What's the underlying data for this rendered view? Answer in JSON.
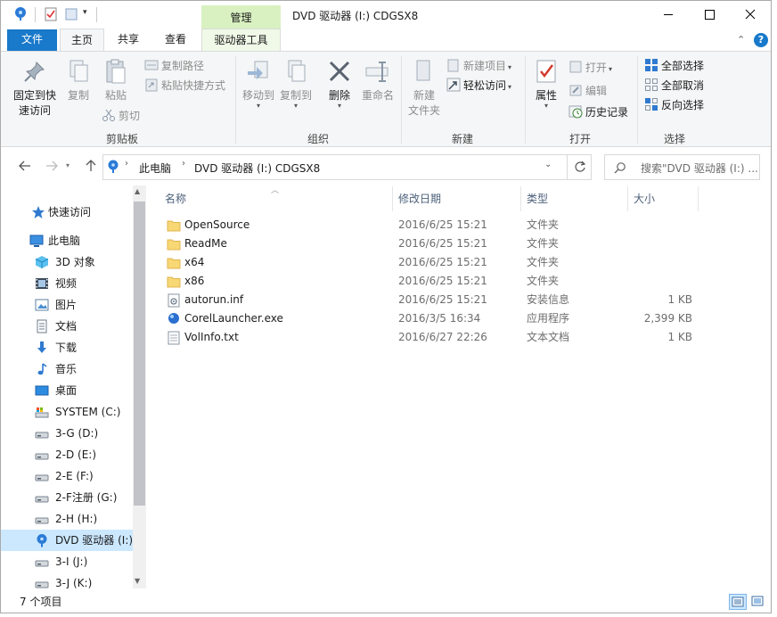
{
  "window": {
    "title": "DVD 驱动器 (I:) CDGSX8",
    "context_group": "管理"
  },
  "tabs": [
    {
      "label": "文件"
    },
    {
      "label": "主页"
    },
    {
      "label": "共享"
    },
    {
      "label": "查看"
    },
    {
      "label": "驱动器工具"
    }
  ],
  "ribbon": {
    "clipboard": {
      "pin": "固定到快\n速访问",
      "copy": "复制",
      "paste": "粘贴",
      "copy_path": "复制路径",
      "paste_shortcut": "粘贴快捷方式",
      "cut": "剪切",
      "label": "剪贴板"
    },
    "organize": {
      "move_to": "移动到",
      "copy_to": "复制到",
      "delete": "删除",
      "rename": "重命名",
      "label": "组织"
    },
    "new": {
      "new_folder": "新建\n文件夹",
      "new_item": "新建项目",
      "easy_access": "轻松访问",
      "label": "新建"
    },
    "open": {
      "properties": "属性",
      "open": "打开",
      "edit": "编辑",
      "history": "历史记录",
      "label": "打开"
    },
    "select": {
      "select_all": "全部选择",
      "select_none": "全部取消",
      "invert": "反向选择",
      "label": "选择"
    }
  },
  "address": {
    "crumbs": [
      "此电脑",
      "DVD 驱动器 (I:) CDGSX8"
    ],
    "search_placeholder": "搜索\"DVD 驱动器 (I:) ..."
  },
  "nav": {
    "quick_access": "快速访问",
    "this_pc": "此电脑",
    "items": [
      {
        "label": "3D 对象",
        "icon": "3d-objects-icon"
      },
      {
        "label": "视频",
        "icon": "video-icon"
      },
      {
        "label": "图片",
        "icon": "pictures-icon"
      },
      {
        "label": "文档",
        "icon": "documents-icon"
      },
      {
        "label": "下载",
        "icon": "downloads-icon"
      },
      {
        "label": "音乐",
        "icon": "music-icon"
      },
      {
        "label": "桌面",
        "icon": "desktop-icon"
      },
      {
        "label": "SYSTEM (C:)",
        "icon": "system-drive-icon"
      },
      {
        "label": "3-G (D:)",
        "icon": "drive-icon"
      },
      {
        "label": "2-D (E:)",
        "icon": "drive-icon"
      },
      {
        "label": "2-E (F:)",
        "icon": "drive-icon"
      },
      {
        "label": "2-F注册 (G:)",
        "icon": "drive-icon"
      },
      {
        "label": "2-H (H:)",
        "icon": "drive-icon"
      },
      {
        "label": "DVD 驱动器 (I:)",
        "icon": "dvd-icon"
      },
      {
        "label": "3-I (J:)",
        "icon": "drive-icon"
      },
      {
        "label": "3-J (K:)",
        "icon": "drive-icon"
      }
    ]
  },
  "columns": {
    "name": "名称",
    "date": "修改日期",
    "type": "类型",
    "size": "大小"
  },
  "files": [
    {
      "name": "OpenSource",
      "date": "2016/6/25 15:21",
      "type": "文件夹",
      "size": "",
      "icon": "folder-icon"
    },
    {
      "name": "ReadMe",
      "date": "2016/6/25 15:21",
      "type": "文件夹",
      "size": "",
      "icon": "folder-icon"
    },
    {
      "name": "x64",
      "date": "2016/6/25 15:21",
      "type": "文件夹",
      "size": "",
      "icon": "folder-icon"
    },
    {
      "name": "x86",
      "date": "2016/6/25 15:21",
      "type": "文件夹",
      "size": "",
      "icon": "folder-icon"
    },
    {
      "name": "autorun.inf",
      "date": "2016/6/25 15:21",
      "type": "安装信息",
      "size": "1 KB",
      "icon": "settings-file-icon"
    },
    {
      "name": "CorelLauncher.exe",
      "date": "2016/3/5 16:34",
      "type": "应用程序",
      "size": "2,399 KB",
      "icon": "app-icon"
    },
    {
      "name": "VolInfo.txt",
      "date": "2016/6/27 22:26",
      "type": "文本文档",
      "size": "1 KB",
      "icon": "text-file-icon"
    }
  ],
  "status": {
    "count": "7 个项目"
  },
  "colors": {
    "file_tab": "#1979ca",
    "context_tab": "#d9f1c1",
    "selection": "#cce8ff",
    "folder": "#f8d775"
  }
}
